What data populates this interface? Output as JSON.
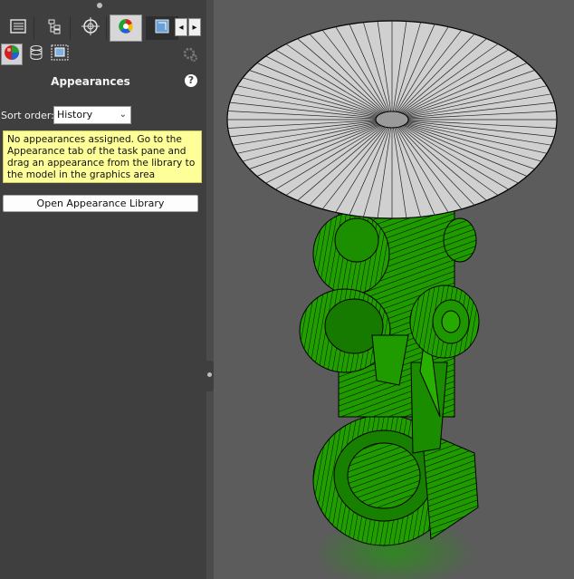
{
  "panel": {
    "tabs": [
      {
        "name": "featuremanager-tab",
        "icon": "feature-tree-icon"
      },
      {
        "name": "propertymanager-tab",
        "icon": "property-tree-icon"
      },
      {
        "name": "configurationmanager-tab",
        "icon": "crosshair-target-icon"
      },
      {
        "name": "displaymanager-tab",
        "icon": "color-wheel-icon",
        "active": true
      },
      {
        "name": "cam-tab",
        "icon": "cube-tool-icon"
      }
    ],
    "subtabs": [
      {
        "name": "appearances-subtab",
        "icon": "color-sphere-icon",
        "active": true
      },
      {
        "name": "decals-subtab",
        "icon": "cylinder-stack-icon"
      },
      {
        "name": "scenes-subtab",
        "icon": "scene-grid-icon"
      }
    ],
    "section_title": "Appearances",
    "sort_order_label": "Sort order:",
    "sort_order_value": "History",
    "notice": "No appearances assigned. Go to the Appearance tab of the task pane and drag an appearance from the library to the model in the graphics area",
    "open_library_button": "Open Appearance Library"
  },
  "colors": {
    "panel_bg": "#3f3f3f",
    "viewport_bg": "#5c5c5c",
    "notice_bg": "#ffff99",
    "model_green": "#1f9b00",
    "disc_gray": "#cfcfcf"
  }
}
